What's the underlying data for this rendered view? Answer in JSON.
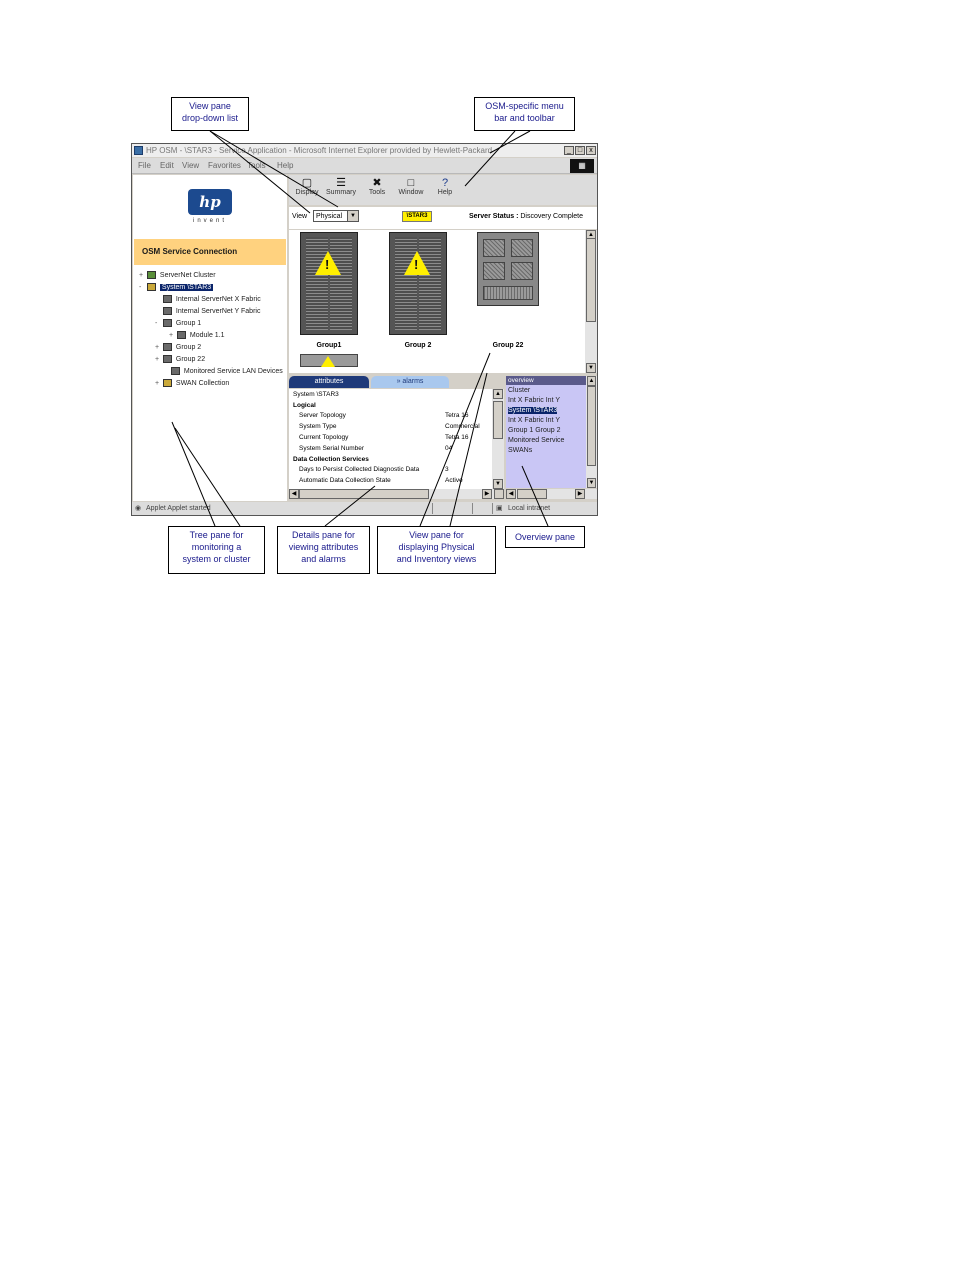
{
  "callouts": {
    "view_dropdown": {
      "line1": "View pane",
      "line2": "drop-down list"
    },
    "osm_menu": {
      "line1": "OSM-specific menu",
      "line2": "bar and toolbar"
    },
    "tree_pane": {
      "line1": "Tree pane for",
      "line2": "monitoring a",
      "line3": "system or cluster"
    },
    "details_pane": {
      "line1": "Details pane for",
      "line2": "viewing attributes",
      "line3": "and alarms"
    },
    "view_pane": {
      "line1": "View pane for",
      "line2": "displaying Physical",
      "line3": "and Inventory views"
    },
    "overview_pane": {
      "line1": "Overview pane"
    }
  },
  "window": {
    "title": "HP OSM - \\STAR3 - Service Application - Microsoft Internet Explorer provided by Hewlett-Packard",
    "controls": {
      "minimize": "_",
      "maximize": "□",
      "close": "x"
    }
  },
  "menubar": {
    "file": "File",
    "edit": "Edit",
    "view": "View",
    "favorites": "Favorites",
    "tools": "Tools",
    "help": "Help"
  },
  "tree": {
    "logo_text": "hp",
    "logo_sub": "invent",
    "header": "OSM Service Connection",
    "nodes": [
      {
        "label": "ServerNet Cluster",
        "exp": "+"
      },
      {
        "label": "System \\STAR3",
        "exp": "-"
      },
      {
        "label": "Internal ServerNet X Fabric",
        "exp": ""
      },
      {
        "label": "Internal ServerNet Y Fabric",
        "exp": ""
      },
      {
        "label": "Group 1",
        "exp": "-"
      },
      {
        "label": "Module 1.1",
        "exp": "+"
      },
      {
        "label": "Group 2",
        "exp": "+"
      },
      {
        "label": "Group 22",
        "exp": "+"
      },
      {
        "label": "Monitored Service LAN Devices",
        "exp": ""
      },
      {
        "label": "SWAN Collection",
        "exp": "+"
      }
    ]
  },
  "toolbar": {
    "display": "Display",
    "summary": "Summary",
    "tools": "Tools",
    "window": "Window",
    "help": "Help"
  },
  "viewrow": {
    "label": "View",
    "selected": "Physical",
    "system_badge": "\\STAR3",
    "server_status_label": "Server Status :",
    "server_status_value": "Discovery Complete"
  },
  "viewpane": {
    "groups": [
      "Group1",
      "Group 2",
      "Group 22"
    ]
  },
  "tabs": {
    "attributes": "attributes",
    "alarms": "alarms"
  },
  "details": {
    "system": "System \\STAR3",
    "logical": "Logical",
    "rows": [
      {
        "label": "Server Topology",
        "value": "Tetra 16"
      },
      {
        "label": "System Type",
        "value": "Commercial"
      },
      {
        "label": "Current Topology",
        "value": "Tetra 16"
      },
      {
        "label": "System Serial Number",
        "value": "04"
      }
    ],
    "dcs_heading": "Data Collection Services",
    "dcs_rows": [
      {
        "label": "Days to Persist Collected Diagnostic Data",
        "value": "3"
      },
      {
        "label": "Automatic Data Collection State",
        "value": "Active"
      }
    ]
  },
  "overview": {
    "title": "overview",
    "items": [
      "Cluster",
      "Int X Fabric  Int Y",
      "System \\STAR3",
      "Int X Fabric  Int Y",
      "Group 1  Group 2",
      "Monitored Service",
      "SWANs"
    ]
  },
  "statusbar": {
    "left": "Applet Applet started",
    "right": "Local intranet"
  },
  "colors": {
    "osm_band": "#ffd27f",
    "tab_active": "#1f3a7a",
    "tab_inactive": "#a9c8ee",
    "overview_bg": "#c9c6f5",
    "warning": "#ffef00",
    "selection": "#0a246a"
  }
}
